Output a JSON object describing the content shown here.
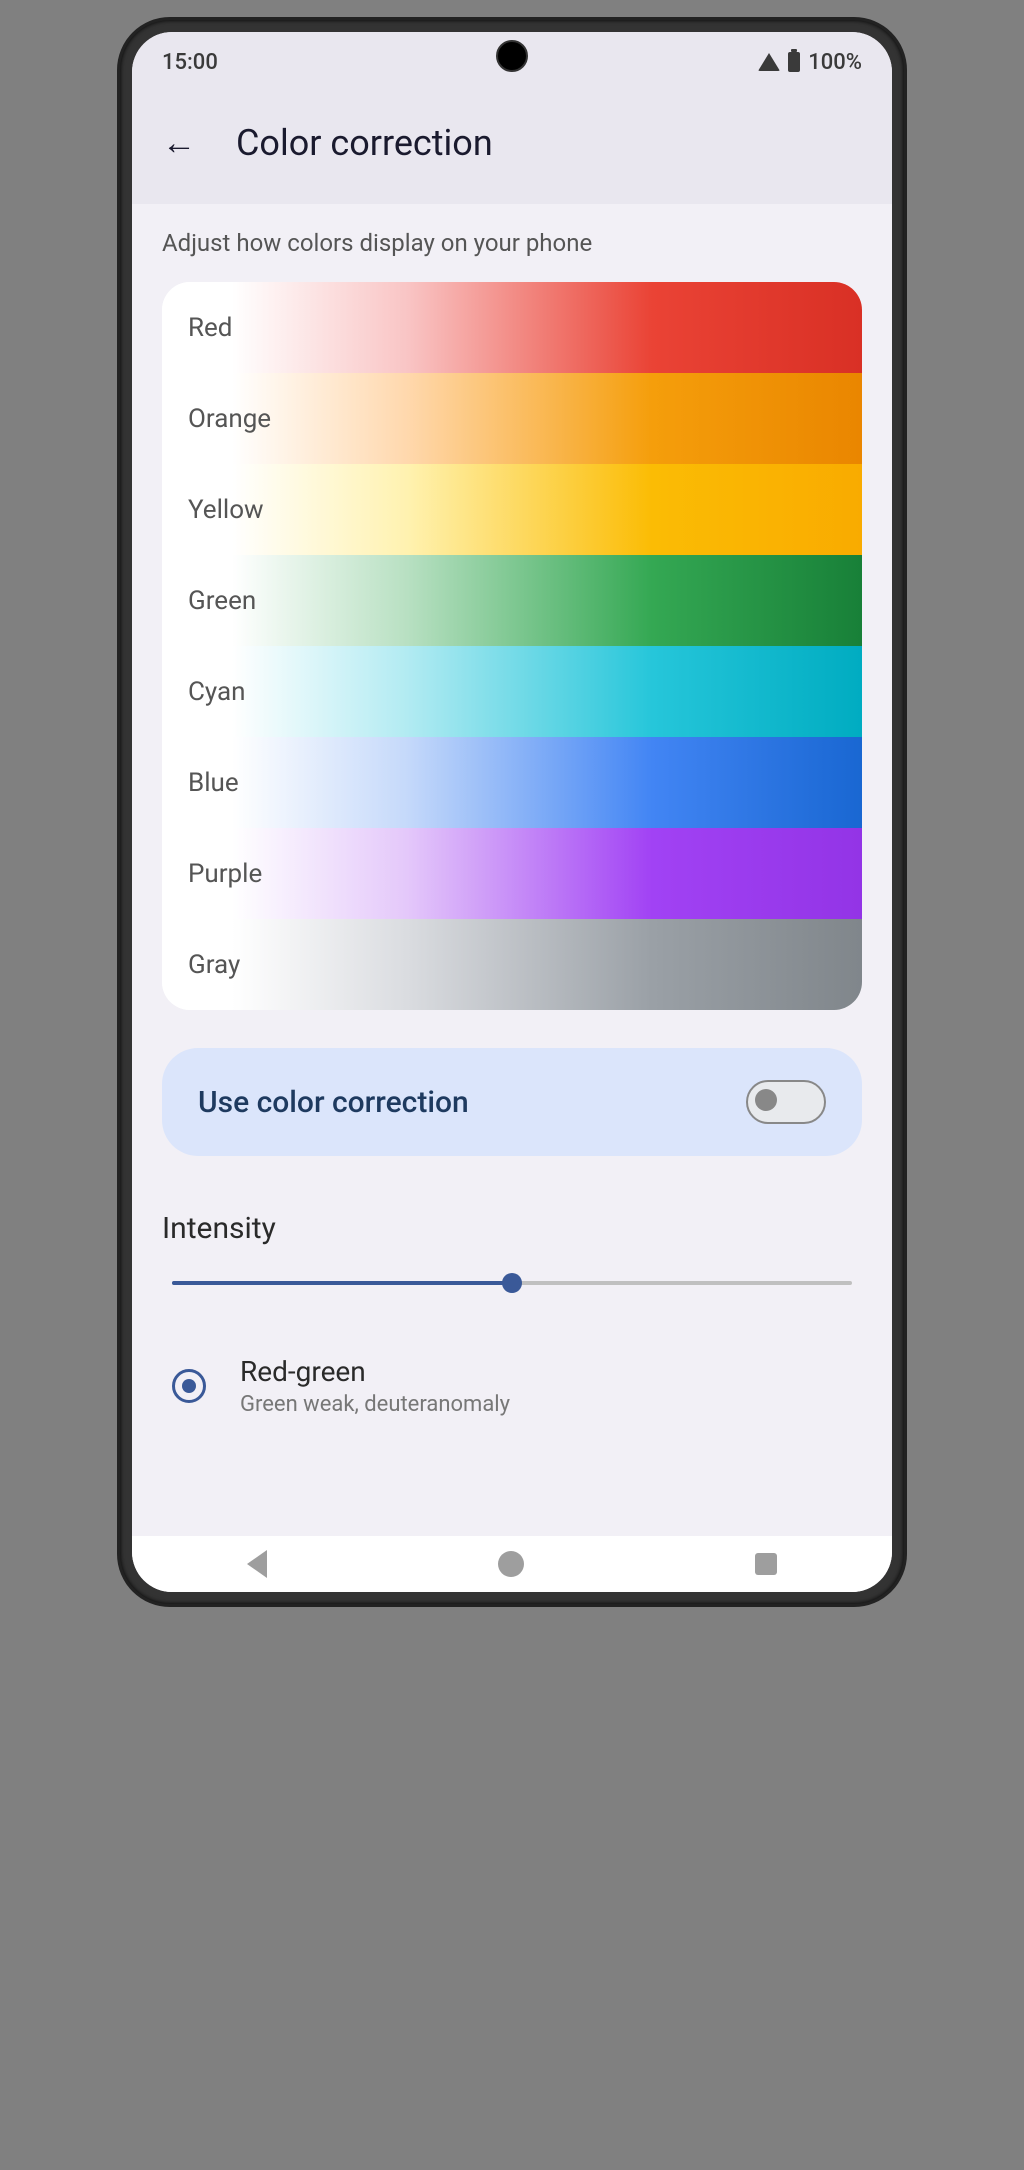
{
  "status": {
    "time": "15:00",
    "battery": "100%"
  },
  "header": {
    "title": "Color correction"
  },
  "subtitle": "Adjust how colors display on your phone",
  "colors": {
    "red": "Red",
    "orange": "Orange",
    "yellow": "Yellow",
    "green": "Green",
    "cyan": "Cyan",
    "blue": "Blue",
    "purple": "Purple",
    "gray": "Gray"
  },
  "toggle": {
    "label": "Use color correction",
    "enabled": false
  },
  "intensity": {
    "label": "Intensity",
    "value": 50
  },
  "option": {
    "title": "Red-green",
    "subtitle": "Green weak, deuteranomaly",
    "selected": true
  }
}
